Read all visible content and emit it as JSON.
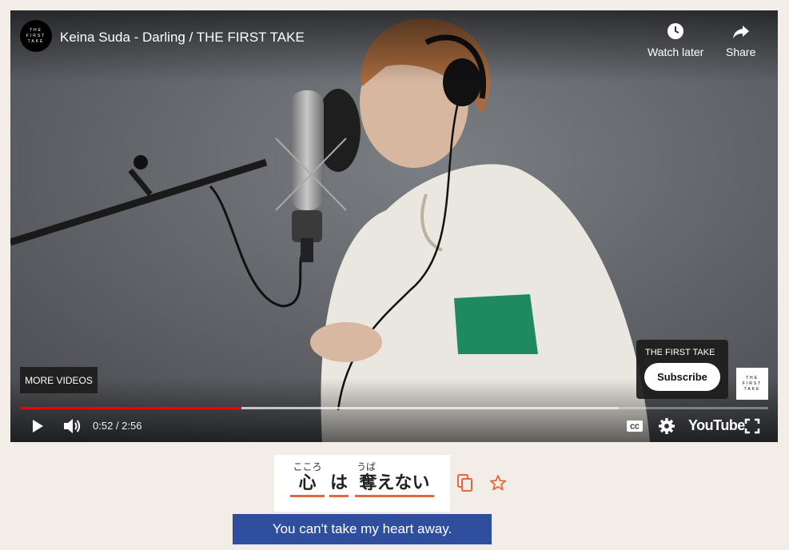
{
  "player": {
    "channel_avatar_text": "THE FIRST TAKE",
    "title": "Keina Suda - Darling / THE FIRST TAKE",
    "watch_later_label": "Watch later",
    "share_label": "Share",
    "more_videos_label": "MORE VIDEOS",
    "subscribe_card": {
      "channel_name": "THE FIRST TAKE",
      "subscribe_label": "Subscribe"
    },
    "channel_logo_text": "THE FIRST TAKE",
    "time_display": "0:52 / 2:56",
    "played_fraction": 0.2955,
    "loaded_fraction": 0.8,
    "youtube_logo": "YouTube",
    "icons": [
      "clock-icon",
      "share-arrow-icon",
      "play-icon",
      "volume-icon",
      "closed-captions-icon",
      "settings-gear-icon",
      "fullscreen-icon"
    ]
  },
  "lyrics": {
    "words": [
      {
        "ruby": "こころ",
        "text": "心"
      },
      {
        "ruby": "",
        "text": "は"
      },
      {
        "ruby": "うば",
        "text": "奪えない"
      }
    ],
    "translation": "You can't take my heart away.",
    "icons": [
      "copy-icon",
      "star-icon"
    ],
    "accent_color": "#e3683f",
    "translation_bg": "#2f4f9e"
  }
}
